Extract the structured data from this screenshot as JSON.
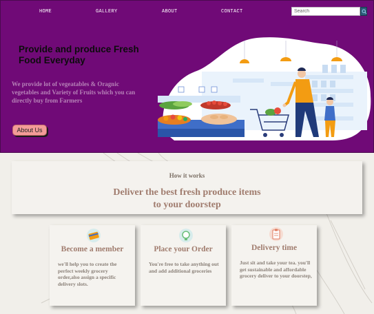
{
  "nav": {
    "home": "HOME",
    "gallery": "GALLERY",
    "about": "ABOUT",
    "contact": "CONTACT",
    "search_placeholder": "Search"
  },
  "hero": {
    "title": "Provide and produce Fresh Food Everyday",
    "description": "We provide lot of vegeatables & Oragnic vegetables and Variety of Fruits which you can directly buy from Farmers",
    "button_label": "About Us"
  },
  "how_it_works": {
    "label": "How it works",
    "heading_line1": "Deliver the best fresh produce items",
    "heading_line2": "to your doorstep"
  },
  "features": [
    {
      "title": "Become a member",
      "text": "we'll help you to create the perfect weekly grocery order,also assign a specific delivery slots.",
      "icon": "card-icon"
    },
    {
      "title": "Place your Order",
      "text": "You're free to take anything out and add additional groceries",
      "icon": "lightbulb-icon"
    },
    {
      "title": "Delivery time",
      "text": "Just sit and take your tea. you'll get sustainable and affordable grocery deliver to your doorstep,",
      "icon": "clipboard-icon"
    }
  ],
  "colors": {
    "hero_bg": "#700a77",
    "button_bg": "#f39b98",
    "heading": "#a07c6e",
    "leaf": "#7cb342"
  }
}
